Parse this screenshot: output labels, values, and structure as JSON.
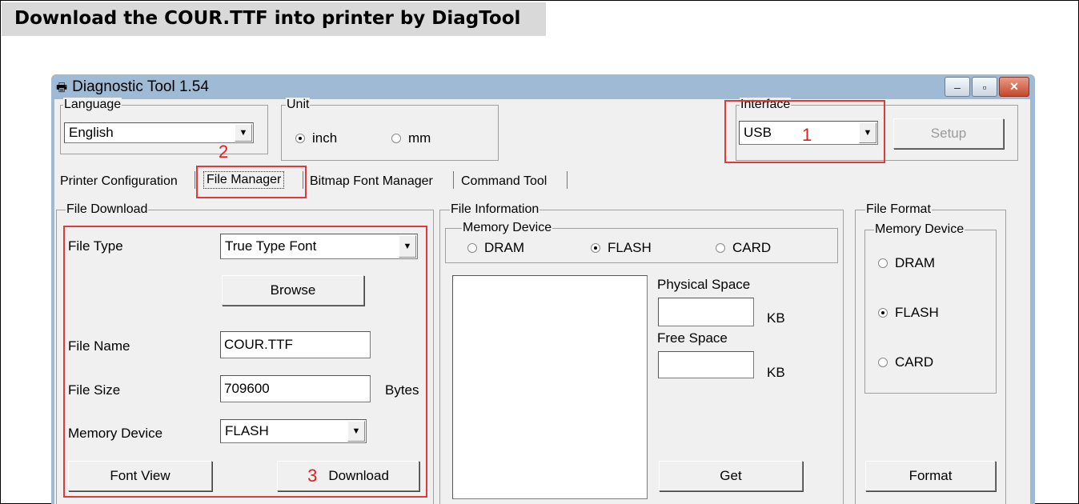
{
  "heading": "Download the COUR.TTF into printer by DiagTool",
  "window": {
    "title": "Diagnostic Tool 1.54",
    "minimize_glyph": "–",
    "maximize_glyph": "▫",
    "close_glyph": "✕"
  },
  "language": {
    "legend": "Language",
    "value": "English"
  },
  "unit": {
    "legend": "Unit",
    "options": [
      "inch",
      "mm"
    ],
    "selected": "inch"
  },
  "interface": {
    "legend": "Interface",
    "value": "USB",
    "setup_label": "Setup"
  },
  "tabs": [
    "Printer Configuration",
    "File Manager",
    "Bitmap Font Manager",
    "Command Tool"
  ],
  "active_tab": "File Manager",
  "file_download": {
    "legend": "File Download",
    "file_type_label": "File Type",
    "file_type_value": "True Type Font",
    "browse_label": "Browse",
    "file_name_label": "File Name",
    "file_name_value": "COUR.TTF",
    "file_size_label": "File Size",
    "file_size_value": "709600",
    "file_size_unit": "Bytes",
    "memory_device_label": "Memory Device",
    "memory_device_value": "FLASH",
    "font_view_label": "Font View",
    "download_label": "Download"
  },
  "file_information": {
    "legend": "File Information",
    "memory_device_legend": "Memory Device",
    "options": [
      "DRAM",
      "FLASH",
      "CARD"
    ],
    "selected": "FLASH",
    "physical_space_label": "Physical Space",
    "free_space_label": "Free Space",
    "kb_unit": "KB",
    "get_label": "Get"
  },
  "file_format": {
    "legend": "File Format",
    "memory_device_legend": "Memory Device",
    "options": [
      "DRAM",
      "FLASH",
      "CARD"
    ],
    "selected": "FLASH",
    "format_label": "Format"
  },
  "annotations": {
    "step1": "1",
    "step2": "2",
    "step3": "3",
    "color": "#e03a3a"
  }
}
